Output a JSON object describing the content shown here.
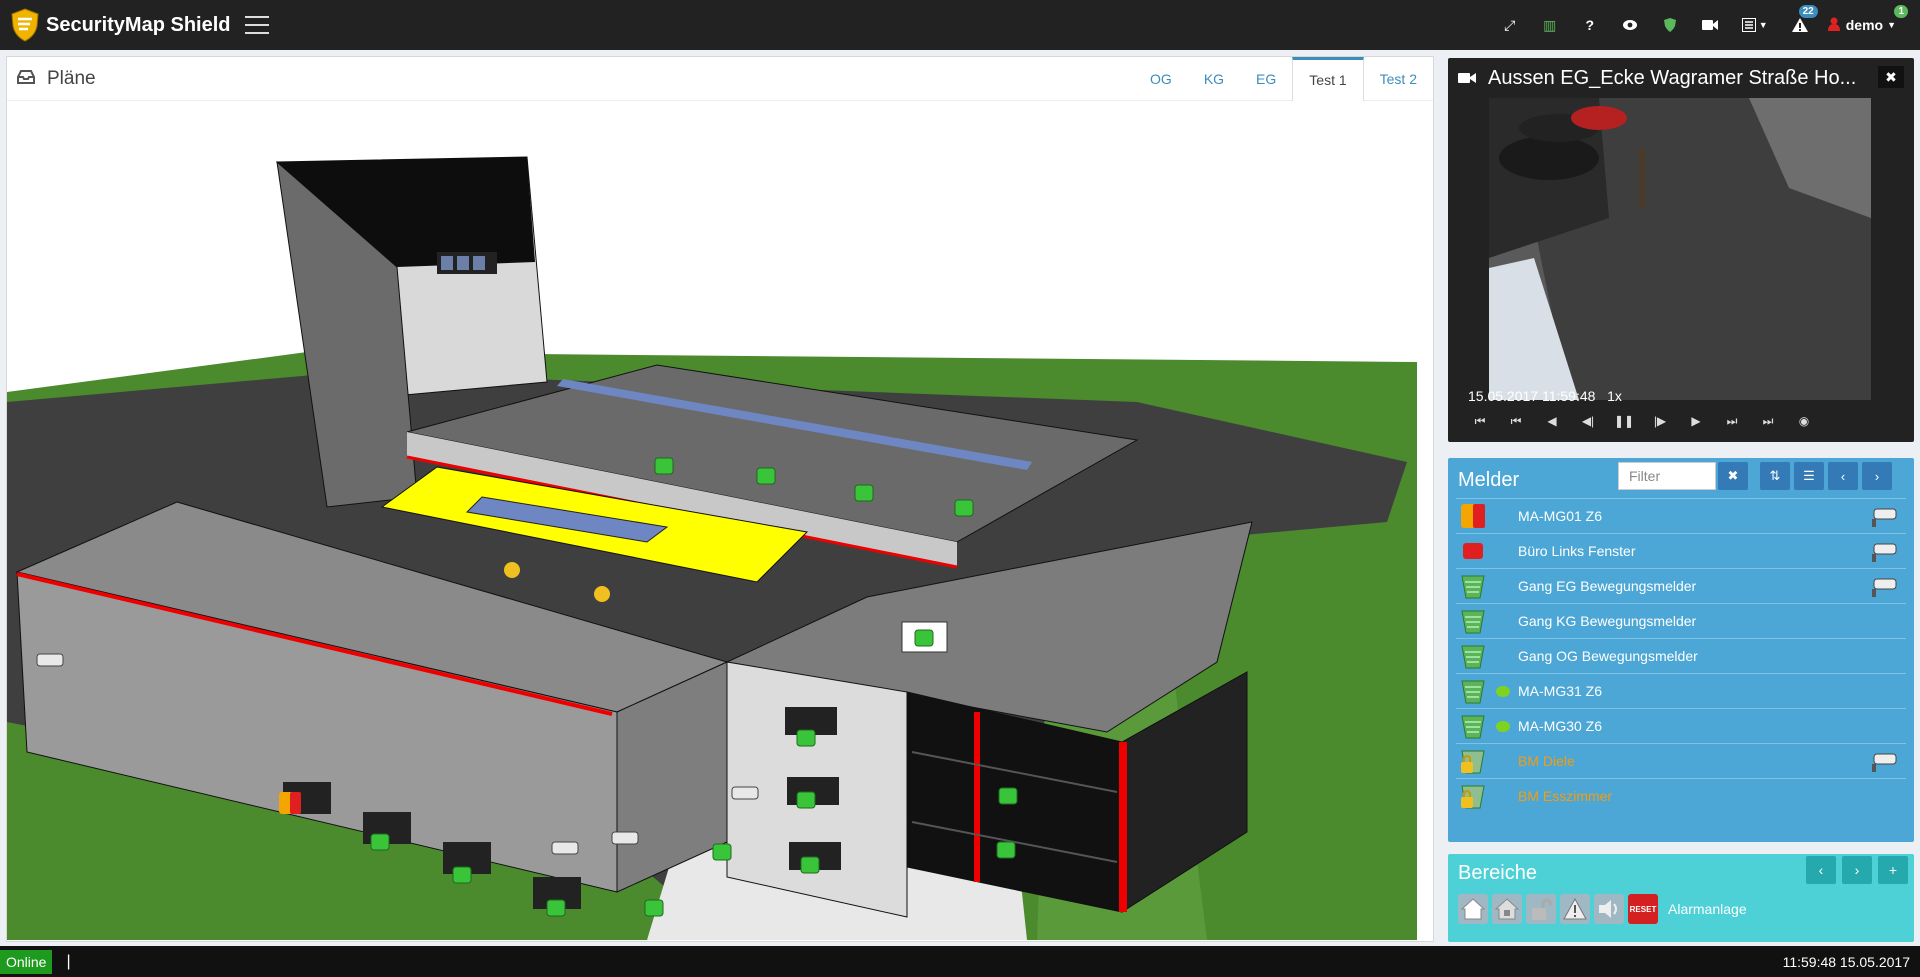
{
  "app": {
    "title": "SecurityMap Shield"
  },
  "nav": {
    "icons": [
      {
        "name": "fullscreen-icon",
        "glyph": "⤢"
      },
      {
        "name": "map-icon",
        "glyph": "▥",
        "color": "#5cb85c"
      },
      {
        "name": "help-icon",
        "glyph": "?"
      },
      {
        "name": "eye-icon",
        "glyph": "👁"
      },
      {
        "name": "shield-icon",
        "glyph": "⛨",
        "color": "#5cb85c"
      },
      {
        "name": "video-camera-icon",
        "glyph": "■"
      },
      {
        "name": "report-icon",
        "glyph": "▤▾"
      }
    ],
    "alert_badge": "22",
    "user_badge": "1",
    "user_name": "demo",
    "colors": {
      "alert_badge": "#3c8dbc",
      "user_badge": "#5cb85c"
    }
  },
  "plans": {
    "title": "Pläne",
    "tabs": [
      {
        "label": "OG",
        "active": false
      },
      {
        "label": "KG",
        "active": false
      },
      {
        "label": "EG",
        "active": false
      },
      {
        "label": "Test 1",
        "active": true
      },
      {
        "label": "Test 2",
        "active": false
      }
    ]
  },
  "camera": {
    "title": "Aussen EG_Ecke Wagramer Straße Ho...",
    "timestamp": "15.05.2017 11:59:48",
    "speed": "1x",
    "controls": [
      "skip-first",
      "step-back-start",
      "rewind",
      "frame-back",
      "pause",
      "frame-forward",
      "play",
      "step-end",
      "skip-last",
      "view"
    ]
  },
  "melder": {
    "title": "Melder",
    "filter_placeholder": "Filter",
    "items": [
      {
        "label": "MA-MG01 Z6",
        "icon": "alarm-orange-red",
        "camera": true,
        "bubble": false,
        "orange": false
      },
      {
        "label": "Büro Links Fenster",
        "icon": "alarm-red",
        "camera": true,
        "bubble": false,
        "orange": false
      },
      {
        "label": "Gang EG Bewegungsmelder",
        "icon": "detector-green",
        "camera": true,
        "bubble": false,
        "orange": false
      },
      {
        "label": "Gang KG Bewegungsmelder",
        "icon": "detector-green",
        "camera": false,
        "bubble": false,
        "orange": false
      },
      {
        "label": "Gang OG Bewegungsmelder",
        "icon": "detector-green",
        "camera": false,
        "bubble": false,
        "orange": false
      },
      {
        "label": "MA-MG31 Z6",
        "icon": "detector-green",
        "camera": false,
        "bubble": true,
        "orange": false
      },
      {
        "label": "MA-MG30 Z6",
        "icon": "detector-green",
        "camera": false,
        "bubble": true,
        "orange": false
      },
      {
        "label": "BM Diele",
        "icon": "detector-locked",
        "camera": true,
        "bubble": false,
        "orange": true
      },
      {
        "label": "BM Esszimmer",
        "icon": "detector-locked",
        "camera": false,
        "bubble": false,
        "orange": true
      }
    ]
  },
  "bereiche": {
    "title": "Bereiche",
    "area_label": "Alarmanlage",
    "reset_label": "RESET"
  },
  "status": {
    "online": "Online",
    "cursor": "|",
    "clock": "11:59:48 15.05.2017"
  }
}
